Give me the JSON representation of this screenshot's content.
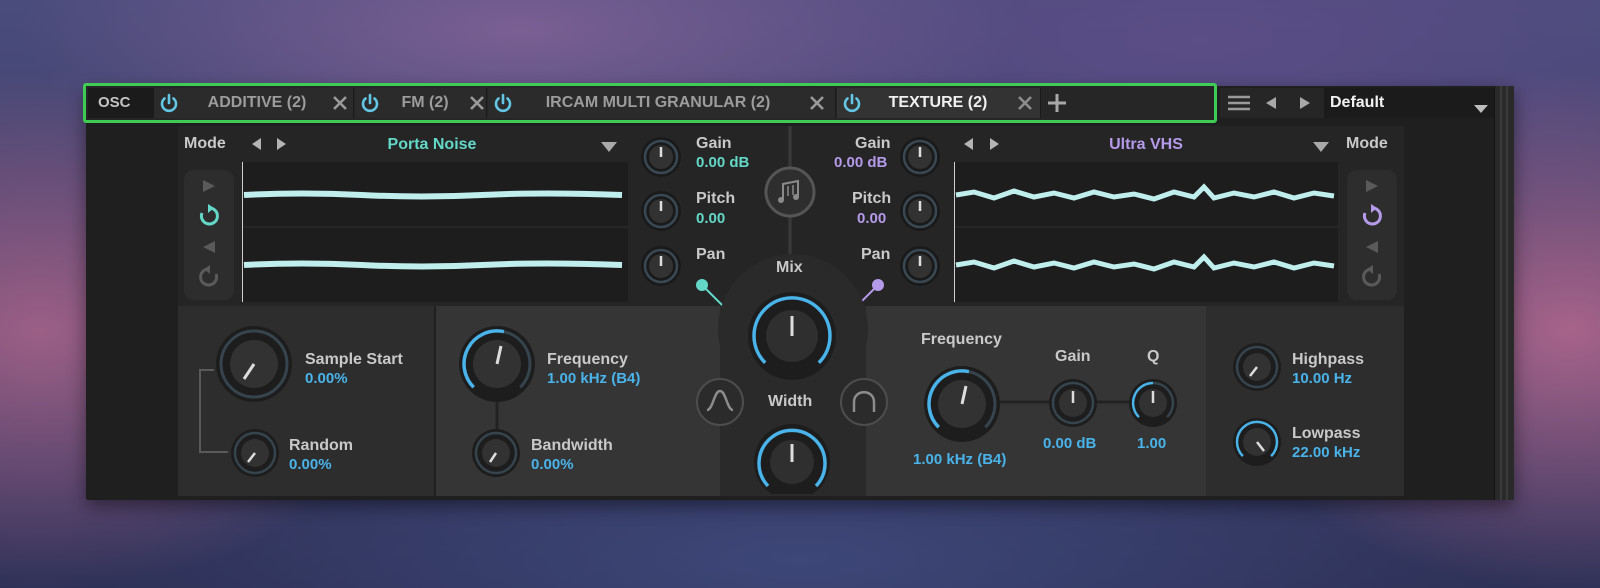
{
  "tabs": {
    "osc_label": "OSC",
    "items": [
      {
        "label": "ADDITIVE (2)"
      },
      {
        "label": "FM (2)"
      },
      {
        "label": "IRCAM MULTI GRANULAR (2)"
      },
      {
        "label": "TEXTURE (2)"
      }
    ],
    "preset": "Default"
  },
  "left": {
    "mode_label": "Mode",
    "preset_name": "Porta Noise",
    "gain_label": "Gain",
    "gain_value": "0.00 dB",
    "pitch_label": "Pitch",
    "pitch_value": "0.00",
    "pan_label": "Pan"
  },
  "right": {
    "mode_label": "Mode",
    "preset_name": "Ultra VHS",
    "gain_label": "Gain",
    "gain_value": "0.00 dB",
    "pitch_label": "Pitch",
    "pitch_value": "0.00",
    "pan_label": "Pan"
  },
  "center": {
    "mix_label": "Mix",
    "width_label": "Width"
  },
  "bottom_left": {
    "sample_start_label": "Sample Start",
    "sample_start_value": "0.00%",
    "random_label": "Random",
    "random_value": "0.00%",
    "frequency_label": "Frequency",
    "frequency_value": "1.00 kHz (B4)",
    "bandwidth_label": "Bandwidth",
    "bandwidth_value": "0.00%"
  },
  "bottom_right": {
    "frequency_label": "Frequency",
    "frequency_value": "1.00 kHz (B4)",
    "gain_label": "Gain",
    "gain_value": "0.00 dB",
    "q_label": "Q",
    "q_value": "1.00",
    "highpass_label": "Highpass",
    "highpass_value": "10.00 Hz",
    "lowpass_label": "Lowpass",
    "lowpass_value": "22.00 kHz"
  },
  "colors": {
    "accent_blue": "#49b3ea",
    "teal": "#63d8c8",
    "purple": "#b59aea",
    "highlight_green": "#3fcc55"
  },
  "icons": [
    "power-icon",
    "close-icon",
    "plus-icon",
    "menu-icon",
    "triangle-left-icon",
    "triangle-right-icon",
    "dropdown-icon",
    "play-icon",
    "loop-icon",
    "reverse-icon",
    "reset-icon",
    "notes-icon",
    "bandpass-shape-icon"
  ]
}
